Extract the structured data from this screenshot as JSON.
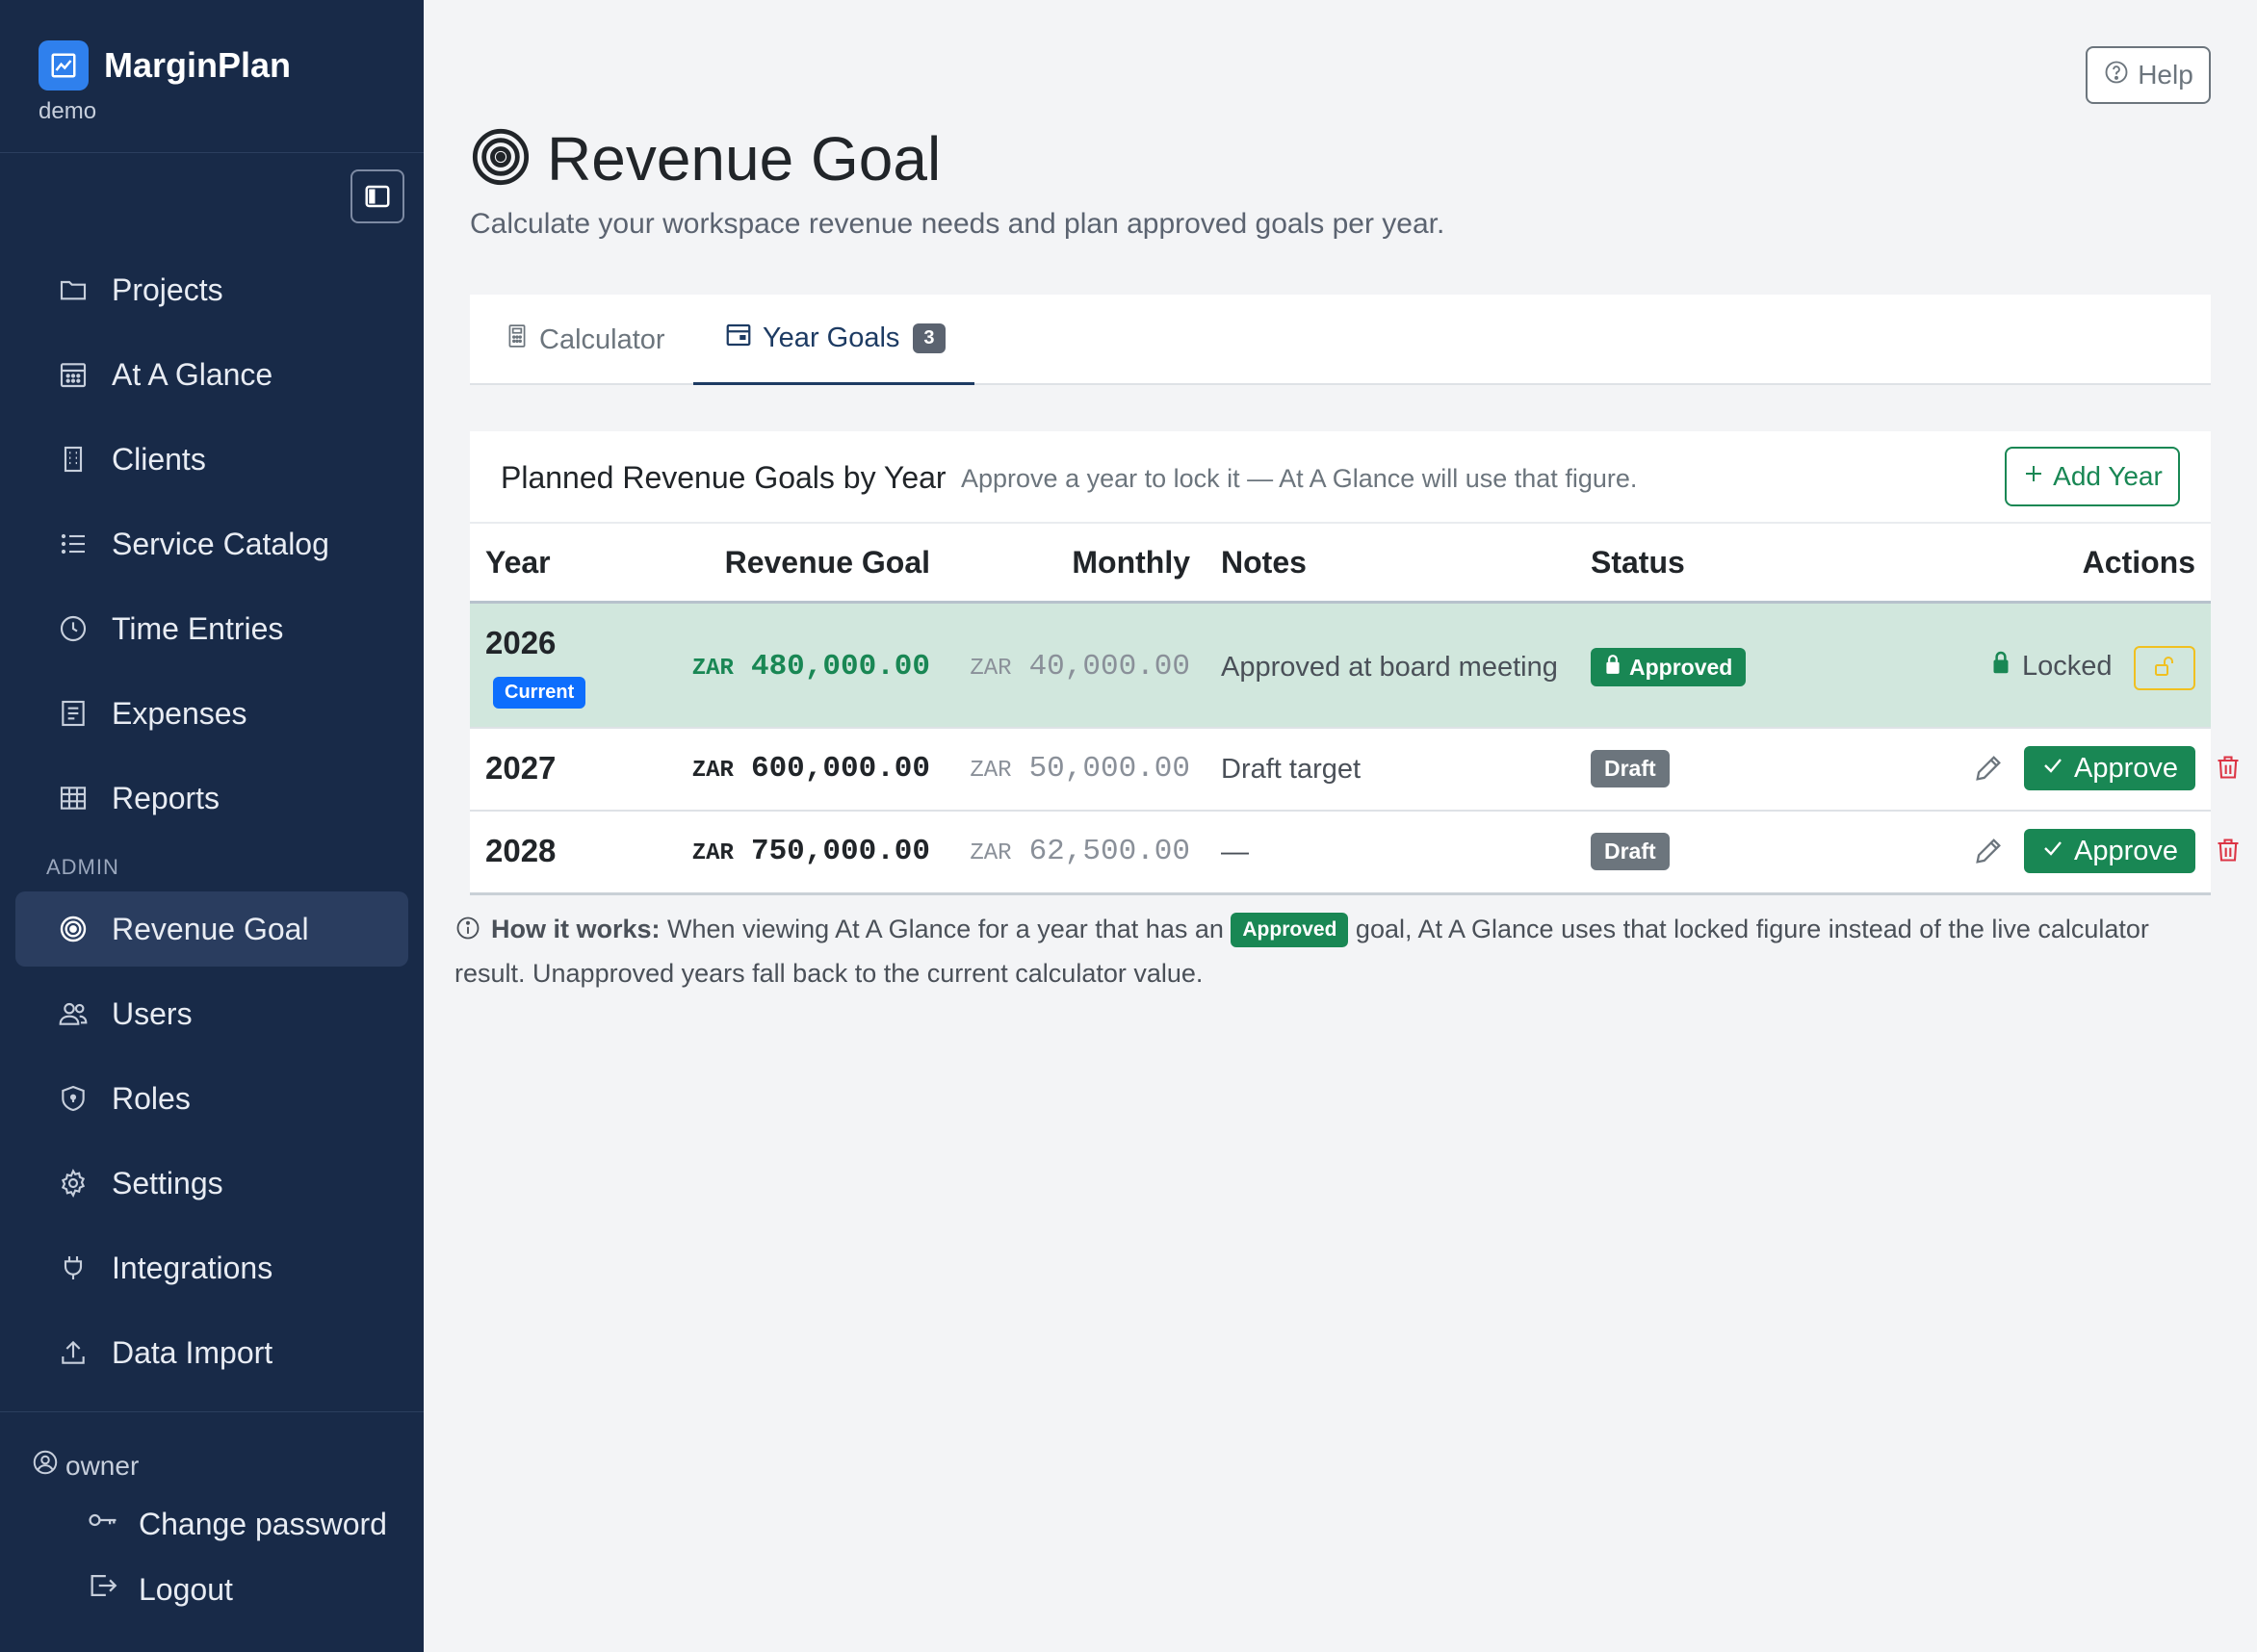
{
  "app": {
    "name": "MarginPlan",
    "workspace": "demo"
  },
  "sidebar": {
    "items": [
      {
        "label": "Projects",
        "icon": "folder-icon"
      },
      {
        "label": "At A Glance",
        "icon": "calendar-grid-icon"
      },
      {
        "label": "Clients",
        "icon": "building-icon"
      },
      {
        "label": "Service Catalog",
        "icon": "list-icon"
      },
      {
        "label": "Time Entries",
        "icon": "clock-icon"
      },
      {
        "label": "Expenses",
        "icon": "receipt-icon"
      },
      {
        "label": "Reports",
        "icon": "table-icon"
      }
    ],
    "admin_label": "ADMIN",
    "admin_items": [
      {
        "label": "Revenue Goal",
        "icon": "target-icon",
        "active": true
      },
      {
        "label": "Users",
        "icon": "users-icon"
      },
      {
        "label": "Roles",
        "icon": "shield-icon"
      },
      {
        "label": "Settings",
        "icon": "gear-icon"
      },
      {
        "label": "Integrations",
        "icon": "plug-icon"
      },
      {
        "label": "Data Import",
        "icon": "upload-icon"
      }
    ],
    "user": "owner",
    "change_password": "Change password",
    "logout": "Logout"
  },
  "header": {
    "help": "Help",
    "title": "Revenue Goal",
    "subtitle": "Calculate your workspace revenue needs and plan approved goals per year."
  },
  "tabs": [
    {
      "label": "Calculator",
      "active": false
    },
    {
      "label": "Year Goals",
      "badge": "3",
      "active": true
    }
  ],
  "card": {
    "title": "Planned Revenue Goals by Year",
    "hint": "Approve a year to lock it — At A Glance will use that figure.",
    "add_button": "Add Year"
  },
  "table": {
    "headers": {
      "year": "Year",
      "goal": "Revenue Goal",
      "monthly": "Monthly",
      "notes": "Notes",
      "status": "Status",
      "actions": "Actions"
    },
    "rows": [
      {
        "year": "2026",
        "current_badge": "Current",
        "currency": "ZAR",
        "goal": "480,000.00",
        "monthly_currency": "ZAR",
        "monthly": "40,000.00",
        "notes": "Approved at board meeting",
        "status": "Approved",
        "locked_label": "Locked"
      },
      {
        "year": "2027",
        "currency": "ZAR",
        "goal": "600,000.00",
        "monthly_currency": "ZAR",
        "monthly": "50,000.00",
        "notes": "Draft target",
        "status": "Draft",
        "approve_label": "Approve"
      },
      {
        "year": "2028",
        "currency": "ZAR",
        "goal": "750,000.00",
        "monthly_currency": "ZAR",
        "monthly": "62,500.00",
        "notes": "—",
        "status": "Draft",
        "approve_label": "Approve"
      }
    ]
  },
  "info": {
    "lead": "How it works:",
    "text_before": "When viewing At A Glance for a year that has an",
    "badge": "Approved",
    "text_after": "goal, At A Glance uses that locked figure instead of the live calculator result. Unapproved years fall back to the current calculator value."
  },
  "colors": {
    "sidebar_bg": "#182a48",
    "brand_blue": "#2f80ed",
    "success": "#198754",
    "primary": "#0d6efd",
    "secondary": "#6c757d",
    "warning": "#f0c020",
    "danger": "#dc3545",
    "current_row": "#d1e7dd"
  }
}
